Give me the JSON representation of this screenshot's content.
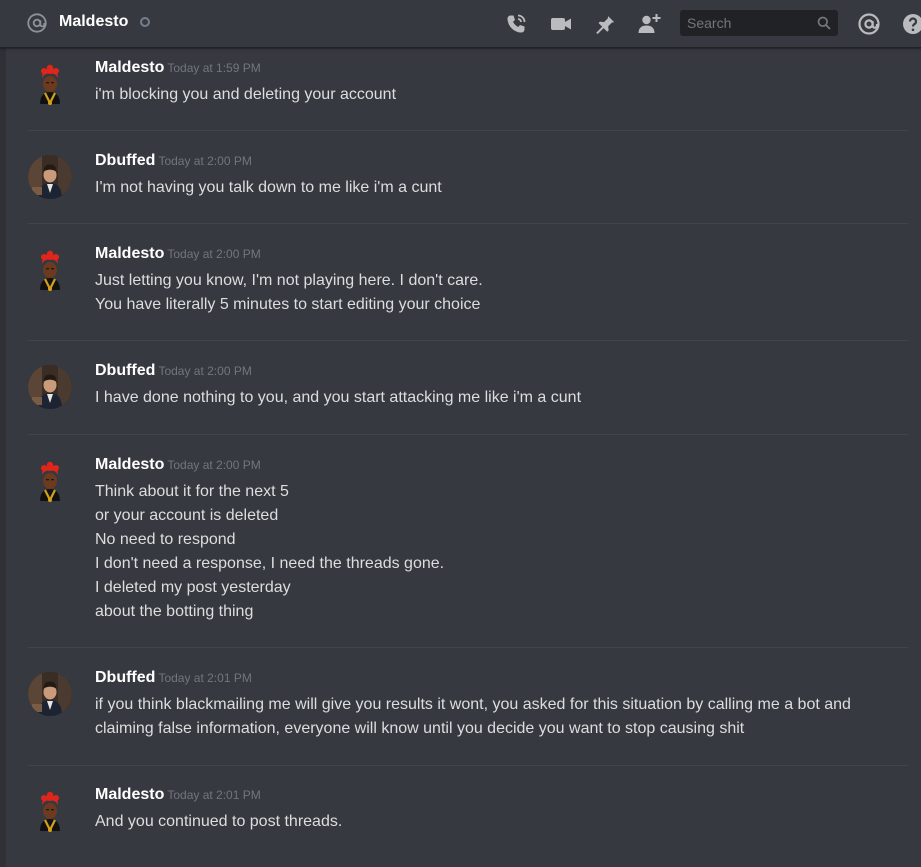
{
  "header": {
    "channel_name": "Maldesto",
    "search_placeholder": "Search",
    "icons": [
      "at-icon",
      "status-offline-icon",
      "call-icon",
      "video-icon",
      "pin-icon",
      "add-friend-icon",
      "search-icon",
      "mentions-icon",
      "help-icon"
    ]
  },
  "messages": [
    {
      "author": "Maldesto",
      "timestamp": "Today at 1:59 PM",
      "lines": [
        "i'm blocking you and deleting your account"
      ]
    },
    {
      "author": "Dbuffed",
      "timestamp": "Today at 2:00 PM",
      "lines": [
        "I'm not having you talk down to me like i'm a cunt"
      ]
    },
    {
      "author": "Maldesto",
      "timestamp": "Today at 2:00 PM",
      "lines": [
        "Just letting you know, I'm not playing here. I don't care.",
        "You have literally 5 minutes to start editing your choice"
      ]
    },
    {
      "author": "Dbuffed",
      "timestamp": "Today at 2:00 PM",
      "lines": [
        "I have done nothing to you, and you start attacking me like i'm a cunt"
      ]
    },
    {
      "author": "Maldesto",
      "timestamp": "Today at 2:00 PM",
      "lines": [
        "Think about it for the next 5",
        "or your account is deleted",
        "No need to respond",
        "I don't need a response, I need the threads gone.",
        "I deleted my post yesterday",
        "about the botting thing"
      ]
    },
    {
      "author": "Dbuffed",
      "timestamp": "Today at 2:01 PM",
      "lines": [
        "if you think blackmailing me will give you results it wont, you asked for this situation by calling me a bot and",
        "claiming false information, everyone will know until you decide you want to stop causing shit"
      ]
    },
    {
      "author": "Maldesto",
      "timestamp": "Today at 2:01 PM",
      "lines": [
        "And you continued to post threads."
      ]
    }
  ],
  "colors": {
    "background": "#36393f",
    "header_text": "#ffffff",
    "message_text": "#dcddde",
    "timestamp": "#72767d",
    "divider": "#42454a"
  }
}
